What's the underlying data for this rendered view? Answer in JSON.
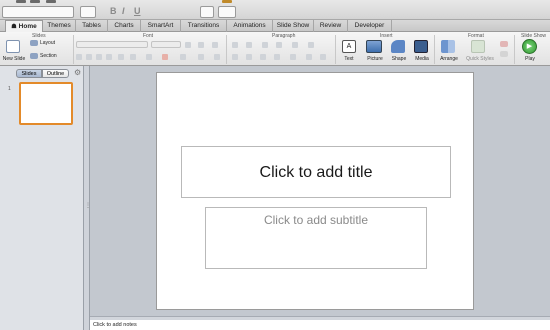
{
  "ribbon_tabs": [
    "Home",
    "Themes",
    "Tables",
    "Charts",
    "SmartArt",
    "Transitions",
    "Animations",
    "Slide Show",
    "Review",
    "Developer"
  ],
  "ribbon_groups": {
    "slides": "Slides",
    "font": "Font",
    "paragraph": "Paragraph",
    "insert": "Insert",
    "format": "Format",
    "slide_show": "Slide Show"
  },
  "slides_group": {
    "new_slide": "New Slide",
    "layout": "Layout",
    "section": "Section"
  },
  "insert_group": {
    "text": "Text",
    "picture": "Picture",
    "shape": "Shape",
    "media": "Media"
  },
  "format_group": {
    "arrange": "Arrange",
    "quick_styles": "Quick Styles"
  },
  "slide_show_group": {
    "play": "Play"
  },
  "left_panel": {
    "slides_tab": "Slides",
    "outline_tab": "Outline",
    "slide_number": "1"
  },
  "slide": {
    "title_placeholder": "Click to add title",
    "subtitle_placeholder": "Click to add subtitle"
  },
  "notes": {
    "placeholder": "Click to add notes"
  },
  "colors": {
    "selection_border": "#e38a2a",
    "active_segment": "#b3c3da"
  },
  "icons": [
    "home-icon",
    "new-slide-icon",
    "layout-icon",
    "section-icon",
    "text-box-icon",
    "picture-icon",
    "shape-icon",
    "media-icon",
    "arrange-icon",
    "quick-styles-icon",
    "play-icon",
    "gear-icon"
  ]
}
